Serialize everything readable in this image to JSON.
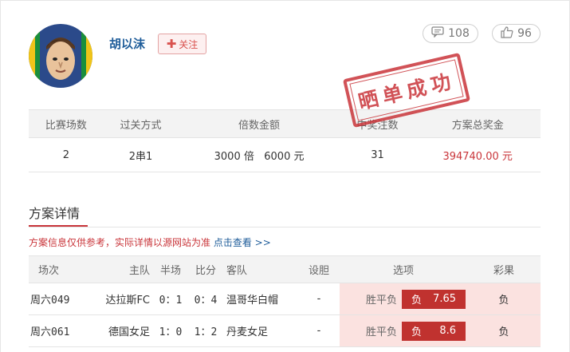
{
  "user": {
    "name": "胡以沫",
    "follow_label": "关注",
    "comment_count": "108",
    "like_count": "96"
  },
  "stamp_text": "晒单成功",
  "summary": {
    "headers": [
      "比赛场数",
      "过关方式",
      "倍数金额",
      "中奖注数",
      "方案总奖金"
    ],
    "values": {
      "matches": "2",
      "pass_type": "2串1",
      "multiple": "3000 倍",
      "amount": "6000 元",
      "winning_bets": "31",
      "prize": "394740.00",
      "prize_unit": "元"
    }
  },
  "section": {
    "title": "方案详情",
    "notice": "方案信息仅供参考，实际详情以源网站为准",
    "notice_link": "点击查看 >>"
  },
  "matches": {
    "headers": [
      "场次",
      "主队",
      "半场",
      "比分",
      "客队",
      "设胆",
      "选项",
      "彩果"
    ],
    "rows": [
      {
        "id": "周六049",
        "home": "达拉斯FC",
        "half": "0：1",
        "score": "0：4",
        "away": "温哥华白帽",
        "banker": "-",
        "pick_type": "胜平负",
        "pick": "负",
        "odds": "7.65",
        "result": "负"
      },
      {
        "id": "周六061",
        "home": "德国女足",
        "half": "1：0",
        "score": "1：2",
        "away": "丹麦女足",
        "banker": "-",
        "pick_type": "胜平负",
        "pick": "负",
        "odds": "8.6",
        "result": "负"
      }
    ]
  },
  "colors": {
    "accent_red": "#c9353a",
    "link_blue": "#1f5d9a",
    "pick_bg": "#fbe2e0"
  }
}
